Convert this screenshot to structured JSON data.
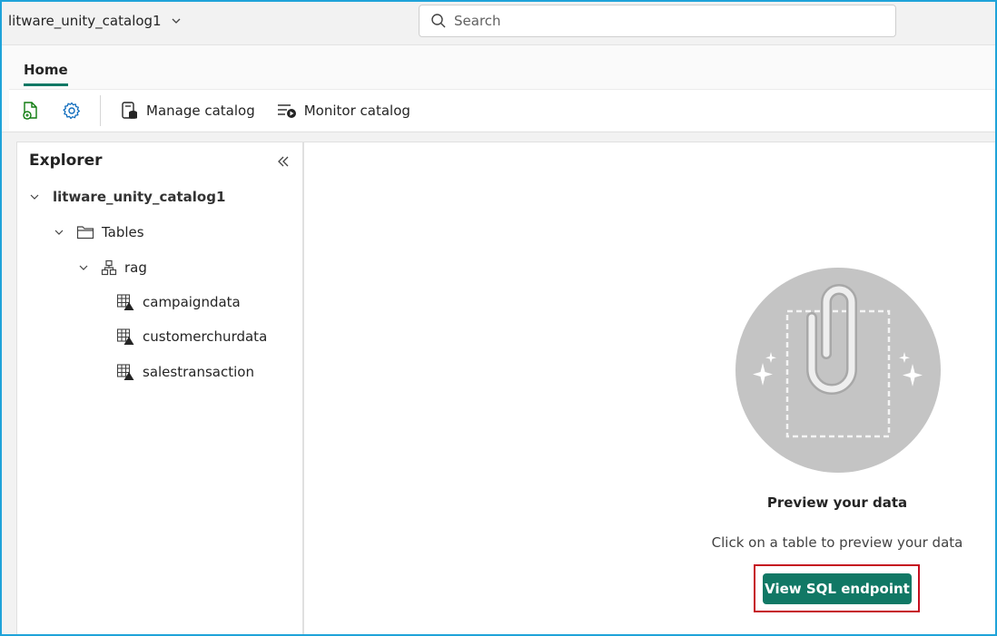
{
  "header": {
    "workspace_title": "litware_unity_catalog1",
    "search_placeholder": "Search"
  },
  "ribbon": {
    "tabs": [
      {
        "label": "Home",
        "selected": true
      }
    ],
    "toolbar": {
      "manage_catalog_label": "Manage catalog",
      "monitor_catalog_label": "Monitor catalog"
    }
  },
  "explorer": {
    "title": "Explorer",
    "tree": {
      "root": "litware_unity_catalog1",
      "folder": "Tables",
      "schema": "rag",
      "tables": [
        "campaigndata",
        "customerchurdata",
        "salestransaction"
      ]
    }
  },
  "preview": {
    "title": "Preview your data",
    "description": "Click on a table to preview your data",
    "button_label": "View SQL endpoint"
  },
  "colors": {
    "accent": "#117865",
    "highlight_border": "#c50f1f",
    "illustration_circle": "#c4c4c4"
  }
}
